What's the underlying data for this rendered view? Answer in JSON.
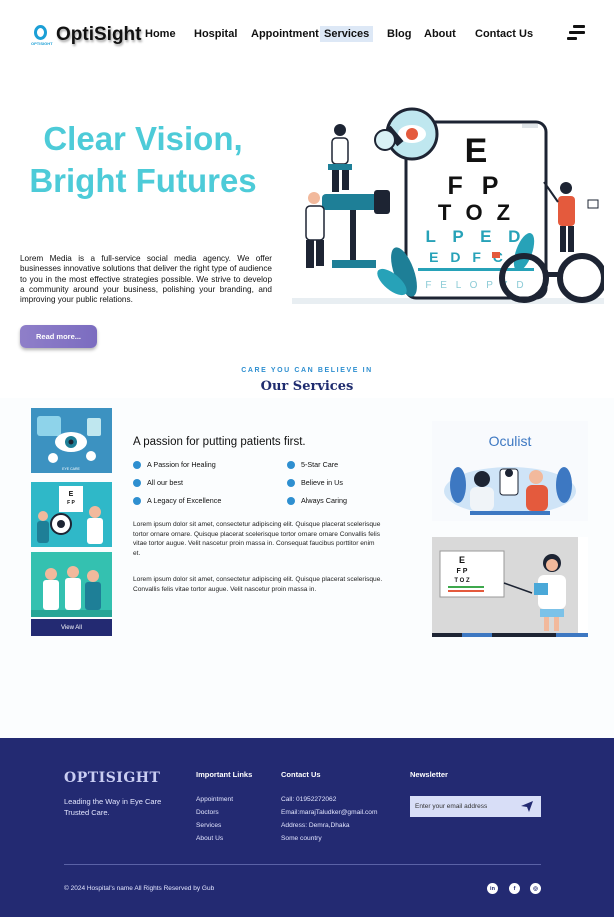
{
  "brand": {
    "name": "OptiSight",
    "tagline": "OPTISIGHT",
    "accent": "#4dcbd8",
    "primary": "#232a72"
  },
  "nav": {
    "items": [
      {
        "label": "Home",
        "active": false
      },
      {
        "label": "Hospital",
        "active": false
      },
      {
        "label": "Appointment",
        "active": false
      },
      {
        "label": "Services",
        "active": true
      },
      {
        "label": "Blog",
        "active": false
      },
      {
        "label": "About",
        "active": false
      },
      {
        "label": "Contact Us",
        "active": false
      }
    ],
    "menu_icon": "hamburger-menu-icon"
  },
  "hero": {
    "title_line1": "Clear Vision,",
    "title_line2": "Bright Futures",
    "description": "Lorem Media is a full-service social media agency. We offer businesses innovative solutions that deliver the right type of audience to you in the most effective strategies possible. We strive to develop a community around your business, polishing your branding, and improving your public relations.",
    "button": "Read more...",
    "chart_letters": [
      "E",
      "F P",
      "T O Z",
      "L P E D",
      "E D F C",
      "F E L O P Z D"
    ]
  },
  "services": {
    "eyebrow": "CARE YOU CAN BELIEVE IN",
    "title": "Our Services",
    "thumb_caption": "EYE CARE",
    "view_all": "View All",
    "passion_title": "A passion for putting patients first.",
    "features_left": [
      "A Passion for Healing",
      "All our best",
      "A Legacy of Excellence"
    ],
    "features_right": [
      "5-Star Care",
      "Believe in Us",
      "Always Caring"
    ],
    "paragraph1": "Lorem ipsum dolor sit amet, consectetur adipiscing elit. Quisque placerat scelerisque tortor ornare ornare. Quisque placerat scelerisque tortor ornare ornare Convallis felis vitae tortor augue. Velit nascetur proin massa in. Consequat faucibus porttitor enim et.",
    "paragraph2": "Lorem ipsum dolor sit amet, consectetur adipiscing elit. Quisque placerat scelerisque. Convallis felis vitae tortor augue. Velit nascetur proin massa in.",
    "oculist_title": "Oculist",
    "small_chart_letters": [
      "E",
      "F P",
      "T O Z"
    ]
  },
  "footer": {
    "brand": "OPTISIGHT",
    "tagline": "Leading the Way in Eye Care Trusted Care.",
    "links_head": "Important Links",
    "links": [
      "Appointment",
      "Doctors",
      "Services",
      "About Us"
    ],
    "contact_head": "Contact Us",
    "contact": [
      "Call: 01952272062",
      "Email:marajTaludker@gmail.com",
      "Address: Demra,Dhaka",
      "Some country"
    ],
    "newsletter_head": "Newsletter",
    "newsletter_placeholder": "Enter your email address",
    "copyright": "© 2024 Hospital's name All Rights Reserved by Gub",
    "social": [
      {
        "icon": "linkedin-icon",
        "glyph": "in"
      },
      {
        "icon": "facebook-icon",
        "glyph": "f"
      },
      {
        "icon": "instagram-icon",
        "glyph": "◎"
      }
    ]
  }
}
